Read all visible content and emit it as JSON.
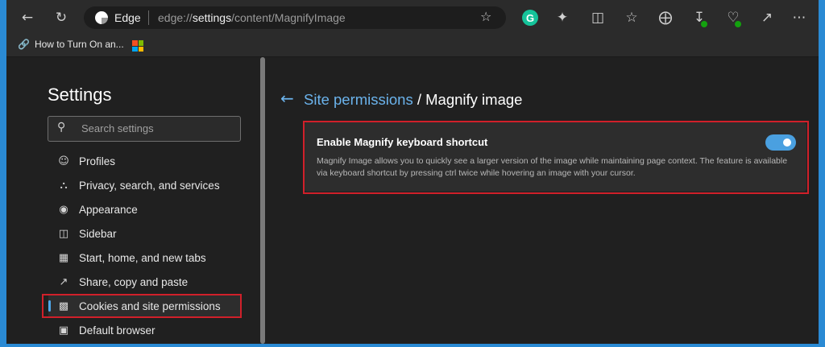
{
  "browser": {
    "brand": "Edge",
    "url_prefix": "edge://",
    "url_host": "settings",
    "url_path": "/content/MagnifyImage"
  },
  "favorites": {
    "items": [
      {
        "label": "How to Turn On an..."
      }
    ]
  },
  "sidebar": {
    "title": "Settings",
    "search_placeholder": "Search settings",
    "items": [
      {
        "label": "Profiles",
        "icon": "profile-icon"
      },
      {
        "label": "Privacy, search, and services",
        "icon": "lock-icon"
      },
      {
        "label": "Appearance",
        "icon": "palette-icon"
      },
      {
        "label": "Sidebar",
        "icon": "sidebar-icon"
      },
      {
        "label": "Start, home, and new tabs",
        "icon": "home-tabs-icon"
      },
      {
        "label": "Share, copy and paste",
        "icon": "share-icon"
      },
      {
        "label": "Cookies and site permissions",
        "icon": "cookies-icon",
        "active": true
      },
      {
        "label": "Default browser",
        "icon": "default-browser-icon"
      }
    ]
  },
  "main": {
    "breadcrumb_link": "Site permissions",
    "breadcrumb_sep": " / ",
    "breadcrumb_current": "Magnify image",
    "setting": {
      "title": "Enable Magnify keyboard shortcut",
      "description": "Magnify Image allows you to quickly see a larger version of the image while maintaining page context. The feature is available via keyboard shortcut by pressing ctrl twice while hovering an image with your cursor.",
      "enabled": true
    }
  },
  "colors": {
    "accent": "#4aa0e0",
    "highlight": "#d0202a",
    "frame_border": "#2a8ad4"
  }
}
